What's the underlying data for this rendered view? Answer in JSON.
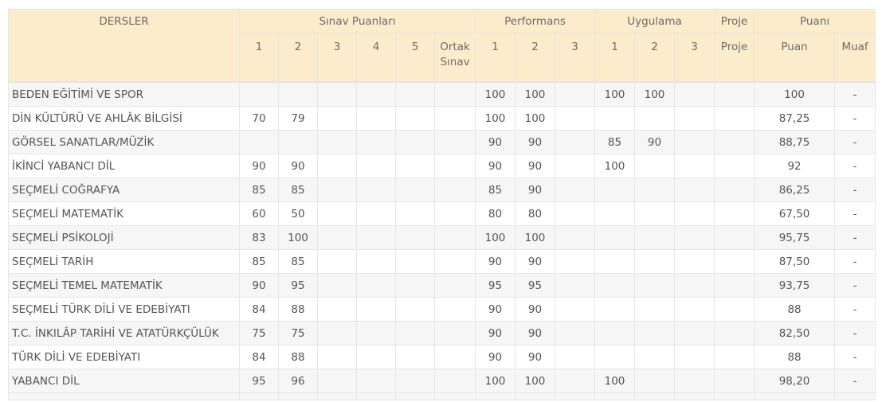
{
  "header": {
    "lesson": "DERSLER",
    "groups": {
      "exam": "Sınav Puanları",
      "performance": "Performans",
      "practice": "Uygulama",
      "project": "Proje",
      "score": "Puanı"
    },
    "sub": {
      "exam": [
        "1",
        "2",
        "3",
        "4",
        "5",
        "Ortak Sınav"
      ],
      "performance": [
        "1",
        "2",
        "3"
      ],
      "practice": [
        "1",
        "2",
        "3"
      ],
      "project": "Proje",
      "score": "Puan",
      "exempt": "Muaf"
    }
  },
  "rows": [
    {
      "name": "BEDEN EĞİTİMİ VE SPOR",
      "cells": [
        "",
        "",
        "",
        "",
        "",
        "",
        "100",
        "100",
        "",
        "100",
        "100",
        "",
        "",
        "100",
        "-"
      ]
    },
    {
      "name": "DİN KÜLTÜRÜ VE AHLÂK BİLGİSİ",
      "cells": [
        "70",
        "79",
        "",
        "",
        "",
        "",
        "100",
        "100",
        "",
        "",
        "",
        "",
        "",
        "87,25",
        "-"
      ]
    },
    {
      "name": "GÖRSEL SANATLAR/MÜZİK",
      "cells": [
        "",
        "",
        "",
        "",
        "",
        "",
        "90",
        "90",
        "",
        "85",
        "90",
        "",
        "",
        "88,75",
        "-"
      ]
    },
    {
      "name": "İKİNCİ YABANCI DİL",
      "cells": [
        "90",
        "90",
        "",
        "",
        "",
        "",
        "90",
        "90",
        "",
        "100",
        "",
        "",
        "",
        "92",
        "-"
      ]
    },
    {
      "name": "SEÇMELİ COĞRAFYA",
      "cells": [
        "85",
        "85",
        "",
        "",
        "",
        "",
        "85",
        "90",
        "",
        "",
        "",
        "",
        "",
        "86,25",
        "-"
      ]
    },
    {
      "name": "SEÇMELİ MATEMATİK",
      "cells": [
        "60",
        "50",
        "",
        "",
        "",
        "",
        "80",
        "80",
        "",
        "",
        "",
        "",
        "",
        "67,50",
        "-"
      ]
    },
    {
      "name": "SEÇMELİ PSİKOLOJİ",
      "cells": [
        "83",
        "100",
        "",
        "",
        "",
        "",
        "100",
        "100",
        "",
        "",
        "",
        "",
        "",
        "95,75",
        "-"
      ]
    },
    {
      "name": "SEÇMELİ TARİH",
      "cells": [
        "85",
        "85",
        "",
        "",
        "",
        "",
        "90",
        "90",
        "",
        "",
        "",
        "",
        "",
        "87,50",
        "-"
      ]
    },
    {
      "name": "SEÇMELİ TEMEL MATEMATİK",
      "cells": [
        "90",
        "95",
        "",
        "",
        "",
        "",
        "95",
        "95",
        "",
        "",
        "",
        "",
        "",
        "93,75",
        "-"
      ]
    },
    {
      "name": "SEÇMELİ TÜRK DİLİ VE EDEBİYATI",
      "cells": [
        "84",
        "88",
        "",
        "",
        "",
        "",
        "90",
        "90",
        "",
        "",
        "",
        "",
        "",
        "88",
        "-"
      ]
    },
    {
      "name": "T.C. İNKILÂP TARİHİ VE ATATÜRKÇÜLÜK",
      "cells": [
        "75",
        "75",
        "",
        "",
        "",
        "",
        "90",
        "90",
        "",
        "",
        "",
        "",
        "",
        "82,50",
        "-"
      ]
    },
    {
      "name": "TÜRK DİLİ VE EDEBİYATI",
      "cells": [
        "84",
        "88",
        "",
        "",
        "",
        "",
        "90",
        "90",
        "",
        "",
        "",
        "",
        "",
        "88",
        "-"
      ]
    },
    {
      "name": "YABANCI DİL",
      "cells": [
        "95",
        "96",
        "",
        "",
        "",
        "",
        "100",
        "100",
        "",
        "100",
        "",
        "",
        "",
        "98,20",
        "-"
      ]
    }
  ]
}
